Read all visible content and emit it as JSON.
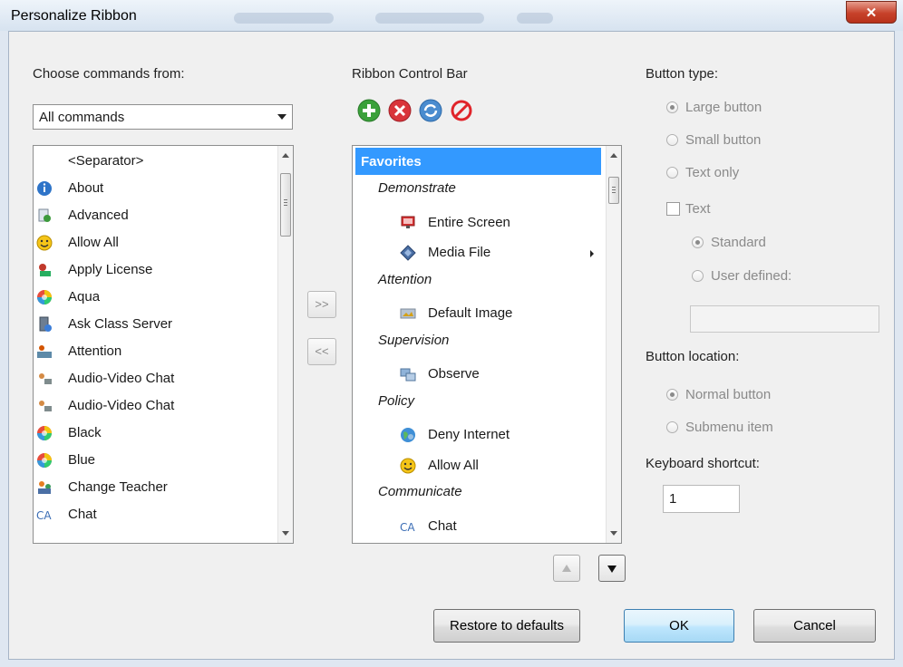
{
  "window": {
    "title": "Personalize Ribbon",
    "close_glyph": "✕"
  },
  "left": {
    "label": "Choose commands from:",
    "combo_value": "All commands",
    "items": [
      {
        "label": "<Separator>",
        "icon": "none"
      },
      {
        "label": "About",
        "icon": "info-icon"
      },
      {
        "label": "Advanced",
        "icon": "advanced-icon"
      },
      {
        "label": "Allow All",
        "icon": "smiley-icon"
      },
      {
        "label": "Apply License",
        "icon": "license-icon"
      },
      {
        "label": "Aqua",
        "icon": "color-wheel-icon"
      },
      {
        "label": "Ask Class Server",
        "icon": "server-icon"
      },
      {
        "label": "Attention",
        "icon": "attention-icon"
      },
      {
        "label": "Audio-Video Chat",
        "icon": "av-chat-icon"
      },
      {
        "label": "Audio-Video Chat",
        "icon": "av-chat-icon"
      },
      {
        "label": "Black",
        "icon": "color-wheel-icon"
      },
      {
        "label": "Blue",
        "icon": "color-wheel-icon"
      },
      {
        "label": "Change Teacher",
        "icon": "teacher-icon"
      },
      {
        "label": "Chat",
        "icon": "chat-icon"
      }
    ]
  },
  "middle": {
    "add_label": ">>",
    "remove_label": "<<"
  },
  "ribbon": {
    "label": "Ribbon Control Bar",
    "toolbar": [
      "add-icon",
      "delete-icon",
      "refresh-icon",
      "block-icon"
    ],
    "favorites": "Favorites",
    "tree": [
      {
        "type": "group",
        "label": "Demonstrate"
      },
      {
        "type": "item",
        "label": "Entire Screen",
        "icon": "screen-icon"
      },
      {
        "type": "item",
        "label": "Media File",
        "icon": "media-file-icon",
        "submenu": true
      },
      {
        "type": "group",
        "label": "Attention"
      },
      {
        "type": "item",
        "label": "Default Image",
        "icon": "image-icon"
      },
      {
        "type": "group",
        "label": "Supervision"
      },
      {
        "type": "item",
        "label": "Observe",
        "icon": "observe-icon"
      },
      {
        "type": "group",
        "label": "Policy"
      },
      {
        "type": "item",
        "label": "Deny Internet",
        "icon": "globe-icon"
      },
      {
        "type": "item",
        "label": "Allow All",
        "icon": "smiley-icon"
      },
      {
        "type": "group",
        "label": "Communicate"
      },
      {
        "type": "item",
        "label": "Chat",
        "icon": "chat-icon"
      }
    ]
  },
  "right": {
    "button_type_label": "Button type:",
    "large_button": "Large button",
    "small_button": "Small button",
    "text_only": "Text only",
    "text": "Text",
    "standard": "Standard",
    "user_defined": "User defined:",
    "button_location_label": "Button location:",
    "normal_button": "Normal button",
    "submenu_item": "Submenu item",
    "keyboard_shortcut_label": "Keyboard shortcut:",
    "keyboard_shortcut_value": "1"
  },
  "footer": {
    "restore": "Restore to defaults",
    "ok": "OK",
    "cancel": "Cancel"
  },
  "colors": {
    "selection": "#3399ff",
    "disabled_text": "#8a8a8a"
  }
}
